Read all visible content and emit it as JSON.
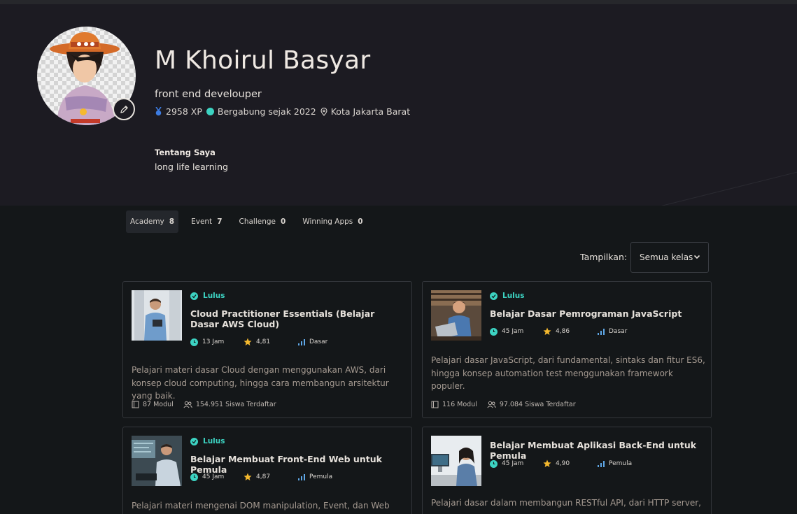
{
  "profile": {
    "name": "M Khoirul Basyar",
    "title": "front end develouper",
    "xp": "2958 XP",
    "joined": "Bergabung sejak 2022",
    "location": "Kota Jakarta Barat",
    "about_heading": "Tentang Saya",
    "about": "long life learning"
  },
  "tabs": [
    {
      "label": "Academy",
      "count": "8"
    },
    {
      "label": "Event",
      "count": "7"
    },
    {
      "label": "Challenge",
      "count": "0"
    },
    {
      "label": "Winning Apps",
      "count": "0"
    }
  ],
  "filter": {
    "label": "Tampilkan:",
    "value": "Semua kelas"
  },
  "courses": [
    {
      "status": "Lulus",
      "title": "Cloud Practitioner Essentials (Belajar Dasar AWS Cloud)",
      "hours": "13 Jam",
      "rating": "4,81",
      "level": "Dasar",
      "description": "Pelajari materi dasar Cloud dengan menggunakan AWS, dari konsep cloud computing, hingga cara membangun arsitektur yang baik.",
      "modules": "87 Modul",
      "students": "154.951 Siswa Terdaftar"
    },
    {
      "status": "Lulus",
      "title": "Belajar Dasar Pemrograman JavaScript",
      "hours": "45 Jam",
      "rating": "4,86",
      "level": "Dasar",
      "description": "Pelajari dasar JavaScript, dari fundamental, sintaks dan fitur ES6, hingga konsep automation test menggunakan framework populer.",
      "modules": "116 Modul",
      "students": "97.084 Siswa Terdaftar"
    },
    {
      "status": "Lulus",
      "title": "Belajar Membuat Front-End Web untuk Pemula",
      "hours": "45 Jam",
      "rating": "4,87",
      "level": "Pemula",
      "description": "Pelajari materi mengenai DOM manipulation, Event, dan Web Storage",
      "modules": "",
      "students": ""
    },
    {
      "status": "",
      "title": "Belajar Membuat Aplikasi Back-End untuk Pemula",
      "hours": "45 Jam",
      "rating": "4,90",
      "level": "Pemula",
      "description": "Pelajari dasar dalam membangun RESTful API, dari HTTP server,",
      "modules": "",
      "students": ""
    }
  ],
  "colors": {
    "accent": "#3cd3c2",
    "star": "#f5b92e",
    "hero_bg": "#1c1b22",
    "page_bg": "#141719"
  }
}
